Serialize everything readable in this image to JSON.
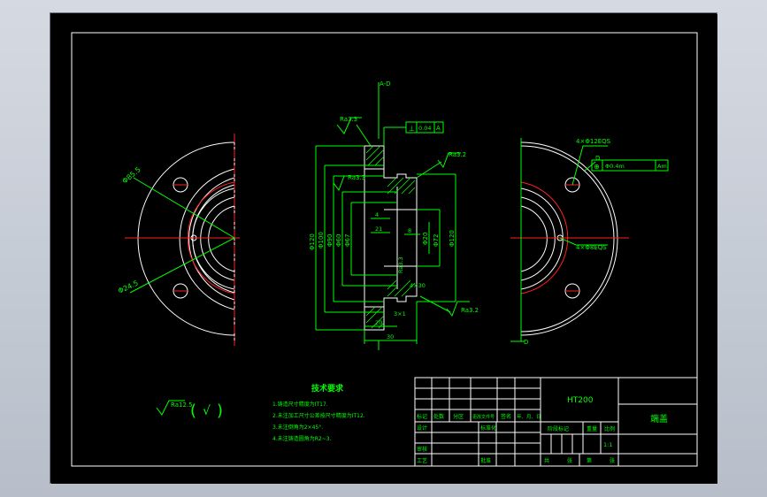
{
  "colors": {
    "background": "#000000",
    "frame": "#ffffff",
    "dimension": "#00ff00",
    "centerline": "#ff2020",
    "hatch": "#00ff00"
  },
  "drawing": {
    "section_marker_top": "A-D",
    "section_marker_bottom": "D",
    "left_view": {
      "pcd_label": "Φ85.5",
      "hole_label": "Φ24.5"
    },
    "section_view": {
      "ra_top": "Ra3.3",
      "ra_upper": "Ra3.2",
      "ra_left": "Ra3.3",
      "ra_inner": "Ra3.3",
      "ra_bottom": "Ra3.2",
      "tolerance_symbol": "⊥",
      "tolerance_value": "0.04",
      "tolerance_datum": "A",
      "dims_left": [
        "Φ120",
        "Φ100",
        "Φ90",
        "Φ60",
        "Φ67"
      ],
      "dims_right": [
        "Φ120",
        "Φ20",
        "Φ72"
      ],
      "dim_inner_1": "4",
      "dim_inner_2": "21",
      "dim_inner_3": "8",
      "dim_chamfer": "4×30",
      "dim_step": "3×1",
      "dim_bottom_1": "20",
      "dim_bottom_2": "30"
    },
    "right_view": {
      "top_callout": "4×Φ12EQS",
      "bottom_callout": "4×Φ8EQS",
      "pos_symbol": "⊕",
      "pos_value": "Φ0.4m",
      "pos_datum": "Am",
      "marker": "D"
    }
  },
  "roughness_note": {
    "value": "Ra12.5",
    "paren_open": "(",
    "check": "√",
    "paren_close": ")"
  },
  "tech_requirements": {
    "title": "技术要求",
    "items": [
      "1.铸造尺寸精度为IT17.",
      "2.未注加工尺寸公差按尺寸精度为IT12.",
      "3.未注倒角为2×45°.",
      "4.未注铸造圆角为R2~3."
    ]
  },
  "title_block": {
    "material": "HT200",
    "part_name": "端盖",
    "headers": [
      "标记",
      "处数",
      "分区",
      "更改文件号",
      "签名",
      "年、月、日"
    ],
    "row_design": "设计",
    "row_standard": "标准化",
    "row_review": "审核",
    "row_process": "工艺",
    "row_approve": "批准",
    "stage_label": "阶段标记",
    "weight_label": "重量",
    "scale_label": "比例",
    "scale_value": "1:1",
    "sheet_total": "共",
    "sheet_total_unit": "张",
    "sheet_no": "第",
    "sheet_no_unit": "张"
  }
}
